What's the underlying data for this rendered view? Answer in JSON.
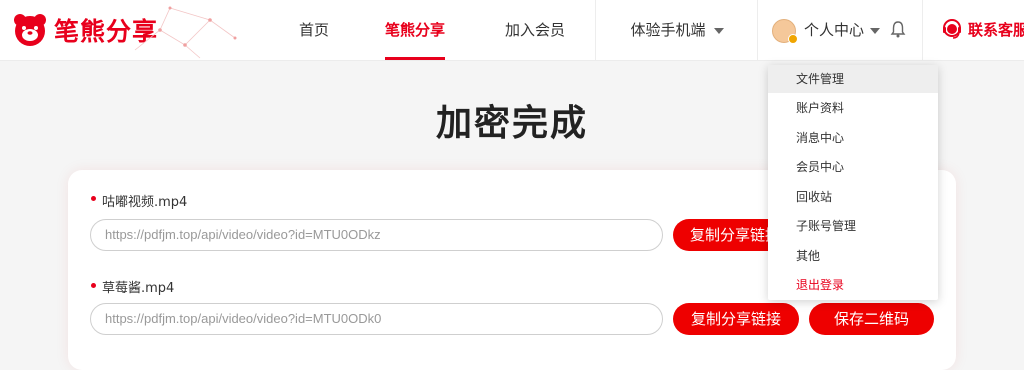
{
  "logo": {
    "text": "笔熊分享"
  },
  "nav": {
    "home": "首页",
    "share": "笔熊分享",
    "join": "加入会员",
    "mobile": "体验手机端",
    "user_center": "个人中心",
    "service": "联系客服"
  },
  "page": {
    "title": "加密完成"
  },
  "files": [
    {
      "name": "咕嘟视频.mp4",
      "link": "https://pdfjm.top/api/video/video?id=MTU0ODkz",
      "copy_label": "复制分享链接"
    },
    {
      "name": "草莓酱.mp4",
      "link": "https://pdfjm.top/api/video/video?id=MTU0ODk0",
      "copy_label": "复制分享链接",
      "qr_label": "保存二维码"
    }
  ],
  "dropdown": {
    "items": [
      "文件管理",
      "账户资料",
      "消息中心",
      "会员中心",
      "回收站",
      "子账号管理",
      "其他",
      "退出登录"
    ]
  },
  "colors": {
    "brand": "#e8001c",
    "button": "#ee0000"
  }
}
